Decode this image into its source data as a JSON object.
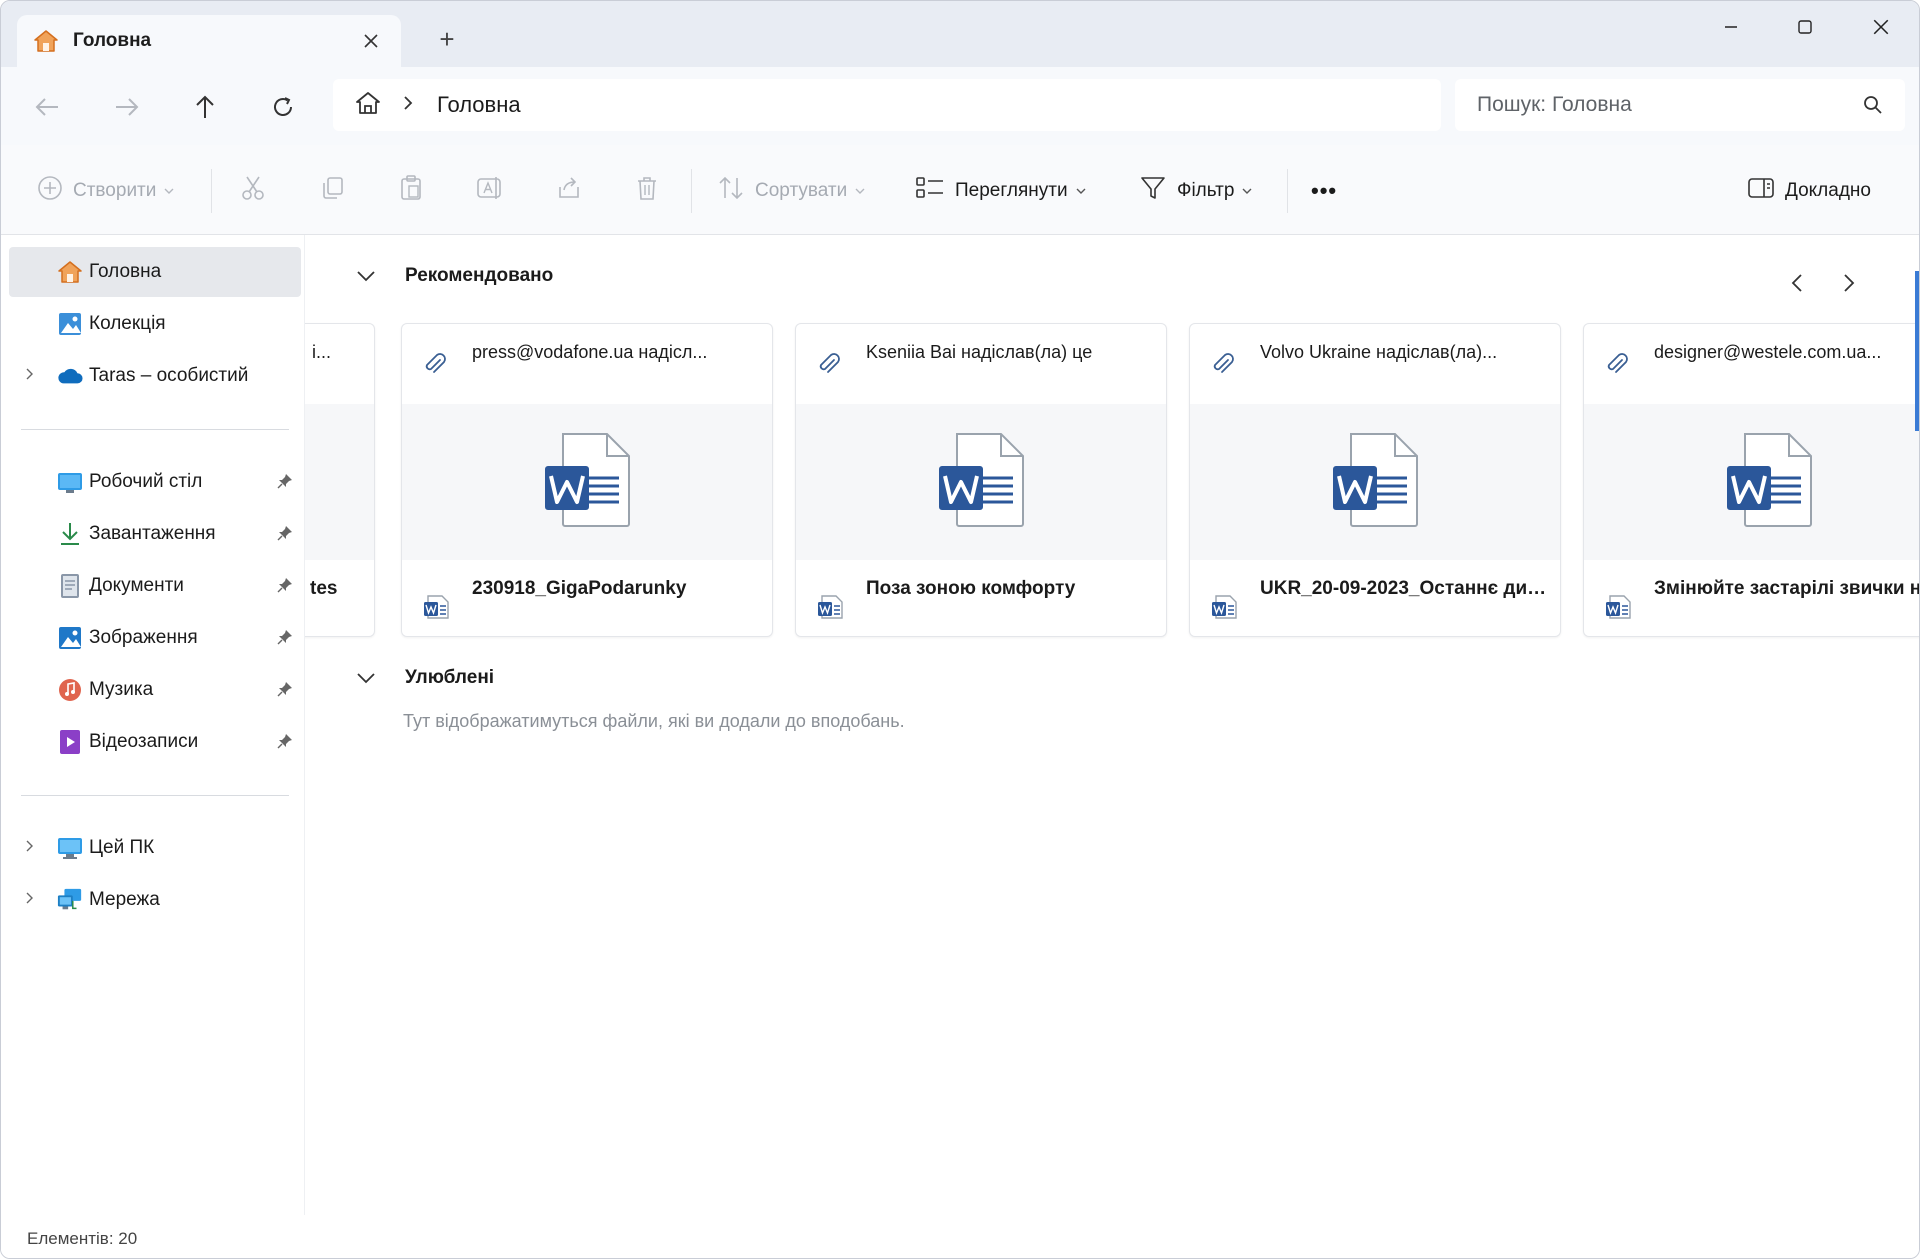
{
  "window": {
    "tab_title": "Головна",
    "tab_icon": "home-icon",
    "new_tab_symbol": "+",
    "controls": [
      "minimize",
      "maximize",
      "close"
    ]
  },
  "address": {
    "breadcrumb": [
      "home-icon",
      "Головна"
    ],
    "current": "Головна",
    "search_placeholder": "Пошук: Головна"
  },
  "commandbar": {
    "new_label": "Створити",
    "sort_label": "Сортувати",
    "view_label": "Переглянути",
    "filter_label": "Фільтр",
    "more_label": "•••",
    "details_label": "Докладно"
  },
  "sidebar": {
    "top_items": [
      {
        "label": "Головна",
        "icon": "home-icon",
        "selected": true
      },
      {
        "label": "Колекція",
        "icon": "gallery-icon"
      },
      {
        "label": "Taras – особистий",
        "icon": "onedrive-cloud-icon",
        "expandable": true
      }
    ],
    "pinned_items": [
      {
        "label": "Робочий стіл",
        "icon": "desktop-folder-icon"
      },
      {
        "label": "Завантаження",
        "icon": "download-icon"
      },
      {
        "label": "Документи",
        "icon": "documents-icon"
      },
      {
        "label": "Зображення",
        "icon": "pictures-icon"
      },
      {
        "label": "Музика",
        "icon": "music-icon"
      },
      {
        "label": "Відеозаписи",
        "icon": "videos-icon"
      }
    ],
    "bottom_items": [
      {
        "label": "Цей ПК",
        "icon": "this-pc-icon",
        "expandable": true
      },
      {
        "label": "Мережа",
        "icon": "network-icon",
        "expandable": true
      }
    ]
  },
  "recommended": {
    "title": "Рекомендовано",
    "cards": [
      {
        "sender": "i...",
        "file": "tes",
        "partial": true
      },
      {
        "sender": "press@vodafone.ua надісл...",
        "file": "230918_GigaPodarunky"
      },
      {
        "sender": "Kseniia Bai надіслав(ла) це",
        "file": "Поза зоною комфорту"
      },
      {
        "sender": "Volvo Ukraine надіслав(ла)...",
        "file": "UKR_20-09-2023_Останнє диз..."
      },
      {
        "sender": "designer@westele.com.ua...",
        "file": "Змінюйте застарілі звички на"
      }
    ]
  },
  "favorites": {
    "title": "Улюблені",
    "empty_text": "Тут відображатимуться файли, які ви додали до вподобань."
  },
  "status": {
    "items_text": "Елементів: 20"
  },
  "colors": {
    "word_blue": "#2b579a",
    "accent": "#3a7bd5",
    "home_orange": "#e8822a"
  }
}
